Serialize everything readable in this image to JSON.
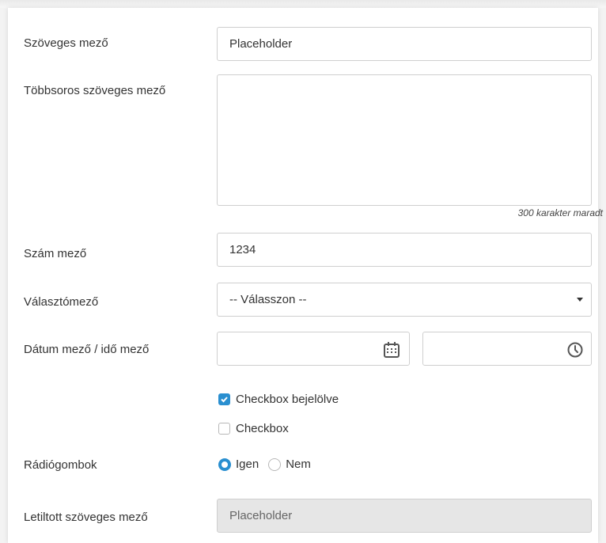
{
  "fields": {
    "text": {
      "label": "Szöveges mező",
      "placeholder": "Placeholder"
    },
    "textarea": {
      "label": "Többsoros szöveges mező",
      "counter": "300 karakter maradt"
    },
    "number": {
      "label": "Szám mező",
      "value": "1234"
    },
    "select": {
      "label": "Választómező",
      "selected": "-- Válasszon --"
    },
    "datetime": {
      "label": "Dátum mező / idő mező"
    },
    "checkboxes": [
      {
        "label": "Checkbox bejelölve",
        "checked": true
      },
      {
        "label": "Checkbox",
        "checked": false
      }
    ],
    "radios": {
      "label": "Rádiógombok",
      "options": [
        {
          "label": "Igen",
          "selected": true
        },
        {
          "label": "Nem",
          "selected": false
        }
      ]
    },
    "disabled": {
      "label": "Letiltott  szöveges mező",
      "placeholder": "Placeholder"
    }
  },
  "colors": {
    "accent": "#2a8fd0",
    "border": "#cfcfcf",
    "disabled_bg": "#e6e6e6"
  },
  "icons": {
    "date": "calendar-icon",
    "time": "clock-icon",
    "select": "caret-down-icon"
  }
}
